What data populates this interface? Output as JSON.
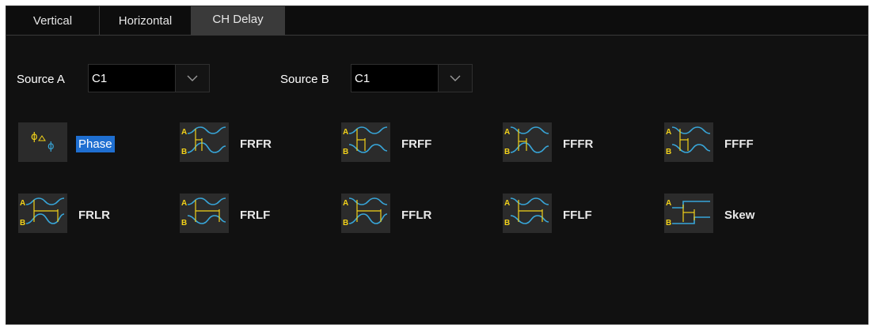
{
  "tabs": [
    {
      "label": "Vertical",
      "active": false
    },
    {
      "label": "Horizontal",
      "active": false
    },
    {
      "label": "CH Delay",
      "active": true
    }
  ],
  "source_a": {
    "label": "Source A",
    "value": "C1"
  },
  "source_b": {
    "label": "Source B",
    "value": "C1"
  },
  "measurements": [
    {
      "label": "Phase",
      "icon": "phase-icon",
      "selected": true
    },
    {
      "label": "FRFR",
      "icon": "frfr-icon"
    },
    {
      "label": "FRFF",
      "icon": "frff-icon"
    },
    {
      "label": "FFFR",
      "icon": "fffr-icon"
    },
    {
      "label": "FFFF",
      "icon": "ffff-icon"
    },
    {
      "label": "FRLR",
      "icon": "frlr-icon"
    },
    {
      "label": "FRLF",
      "icon": "frlf-icon"
    },
    {
      "label": "FFLR",
      "icon": "fflr-icon"
    },
    {
      "label": "FFLF",
      "icon": "fflf-icon"
    },
    {
      "label": "Skew",
      "icon": "skew-icon"
    }
  ],
  "colors": {
    "wave": "#38a6d9",
    "marker": "#f2d21a",
    "selected": "#1f6fd1"
  }
}
